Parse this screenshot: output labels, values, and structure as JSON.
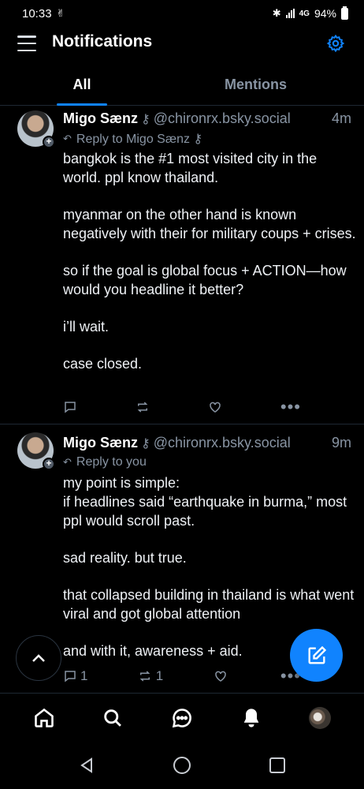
{
  "status_bar": {
    "time": "10:33",
    "network": "4G",
    "battery": "94%"
  },
  "header": {
    "title": "Notifications"
  },
  "tabs": [
    {
      "label": "All",
      "active": true
    },
    {
      "label": "Mentions",
      "active": false
    }
  ],
  "posts": [
    {
      "author": "Migo Sænz",
      "author_key": "⚷",
      "handle": "@chironrx.bsky.social",
      "time": "4m",
      "reply_to": "Reply to Migo Sænz ⚷",
      "paragraphs": [
        "bangkok is the #1 most visited city in the world. ppl know thailand.",
        "myanmar on the other hand is known negatively with their for military coups + crises.",
        "so if the goal is global focus + ACTION—how would you headline it better?",
        "i’ll wait.",
        "case closed."
      ],
      "replies": "",
      "reposts": "",
      "likes": ""
    },
    {
      "author": "Migo Sænz",
      "author_key": "⚷",
      "handle": "@chironrx.bsky.social",
      "time": "9m",
      "reply_to": "Reply to you",
      "paragraphs": [
        "my point is simple:\nif headlines said “earthquake in burma,” most ppl would scroll past.",
        "sad reality. but true.",
        "that collapsed building in thailand is what went viral and got global attention",
        "and with it, awareness + aid."
      ],
      "replies": "1",
      "reposts": "1",
      "likes": ""
    }
  ],
  "more_label": "•••",
  "colors": {
    "accent": "#1083fe",
    "muted": "#8894a3",
    "background": "#000000"
  },
  "icons": {
    "nav": [
      "home-icon",
      "search-icon",
      "chat-icon",
      "bell-icon",
      "profile-avatar"
    ],
    "system": [
      "back-icon",
      "home-circle-icon",
      "recents-icon"
    ]
  }
}
